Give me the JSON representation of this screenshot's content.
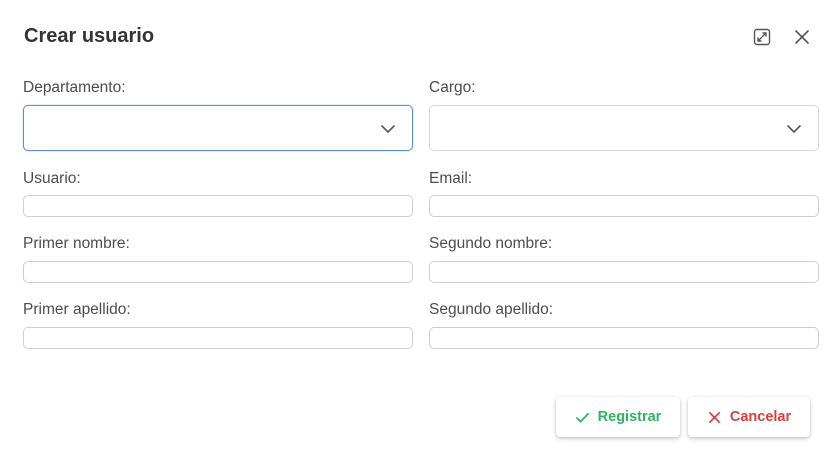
{
  "dialog": {
    "title": "Crear usuario",
    "expand_icon": "expand-icon",
    "close_icon": "close-icon"
  },
  "form": {
    "departamento": {
      "label": "Departamento:",
      "value": ""
    },
    "cargo": {
      "label": "Cargo:",
      "value": ""
    },
    "usuario": {
      "label": "Usuario:",
      "value": ""
    },
    "email": {
      "label": "Email:",
      "value": ""
    },
    "primer_nombre": {
      "label": "Primer nombre:",
      "value": ""
    },
    "segundo_nombre": {
      "label": "Segundo nombre:",
      "value": ""
    },
    "primer_apellido": {
      "label": "Primer apellido:",
      "value": ""
    },
    "segundo_apellido": {
      "label": "Segundo apellido:",
      "value": ""
    }
  },
  "actions": {
    "register_label": "Registrar",
    "register_icon": "check-icon",
    "register_color": "#2fb463",
    "cancel_label": "Cancelar",
    "cancel_icon": "x-icon",
    "cancel_color": "#e03b3b"
  },
  "colors": {
    "focus_border": "#5b8fd6",
    "title": "#333333"
  }
}
